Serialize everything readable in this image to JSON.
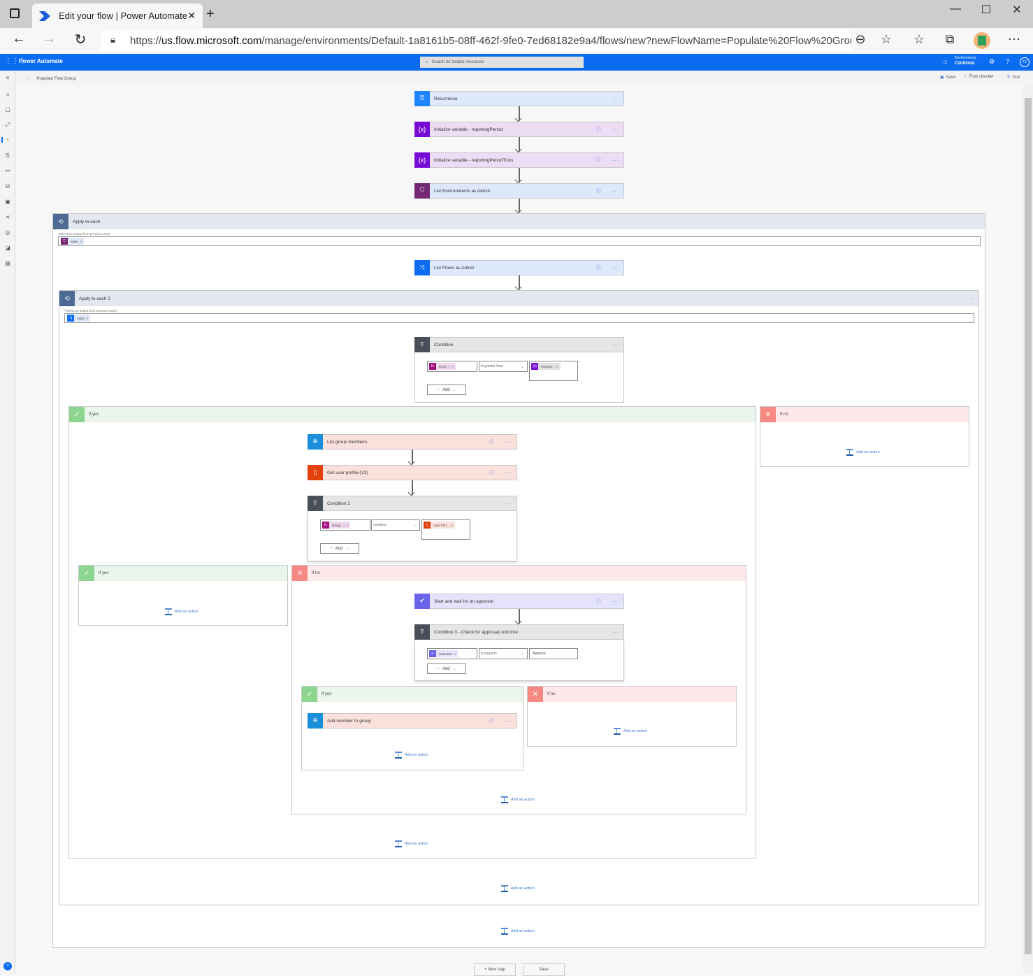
{
  "browser": {
    "tab_title": "Edit your flow | Power Automate",
    "url_prefix": "https://",
    "url_host": "us.flow.microsoft.com",
    "url_rest": "/manage/environments/Default-1a8161b5-08ff-462f-9fe0-7ed68182e9a4/flows/new?newFlowName=Populate%20Flow%20Group&tri...",
    "new_tab": "+",
    "close_tab": "✕"
  },
  "app": {
    "name": "Power Automate",
    "search_placeholder": "Search for helpful resources",
    "env_label": "Environments",
    "env_name": "Contoso",
    "help": "?",
    "avatar_initials": "FJ",
    "breadcrumb": "Populate Flow Group",
    "commands": {
      "save": "Save",
      "flow_checker": "Flow checker",
      "test": "Test"
    }
  },
  "flow": {
    "steps": [
      {
        "label": "Recurrence",
        "icon": "alarm-clock-icon",
        "help": false
      },
      {
        "label": "Initialize variable - reportingPeriod",
        "icon": "variable-icon",
        "help": true
      },
      {
        "label": "Initialize variable - reportingPeriodTicks",
        "icon": "variable-icon",
        "help": true
      },
      {
        "label": "List Environments as Admin",
        "icon": "shield-admin-icon",
        "help": true
      }
    ],
    "apply_each": {
      "label": "Apply to each",
      "select_label": "Select an output from previous steps",
      "token": "value",
      "inner_step": "List Flows as Admin",
      "apply_each_2": {
        "label": "Apply to each 2",
        "select_label": "Select an output from previous steps",
        "token": "value",
        "condition": {
          "label": "Condition",
          "left": "ticks(...)",
          "operator": "is greater than",
          "right": "reportin...",
          "add": "Add"
        },
        "if_yes": {
          "label": "If yes",
          "steps": [
            "List group members",
            "Get user profile (V2)"
          ],
          "condition2": {
            "label": "Condition 2",
            "left": "string(...)",
            "operator": "contains",
            "right": "User Prin...",
            "add": "Add"
          },
          "c2_yes": {
            "label": "If yes"
          },
          "c2_no": {
            "label": "If no",
            "approval": "Start and wait for an approval",
            "condition3": {
              "label": "Condition 3 - Check for approval outcome",
              "left": "Outcome",
              "operator": "is equal to",
              "right": "Approve",
              "add": "Add"
            },
            "c3_yes": {
              "label": "If yes",
              "step": "Add member to group"
            },
            "c3_no": {
              "label": "If no"
            }
          }
        },
        "if_no": {
          "label": "If no"
        }
      }
    },
    "add_action": "Add an action",
    "new_step": "+ New step",
    "save": "Save"
  }
}
